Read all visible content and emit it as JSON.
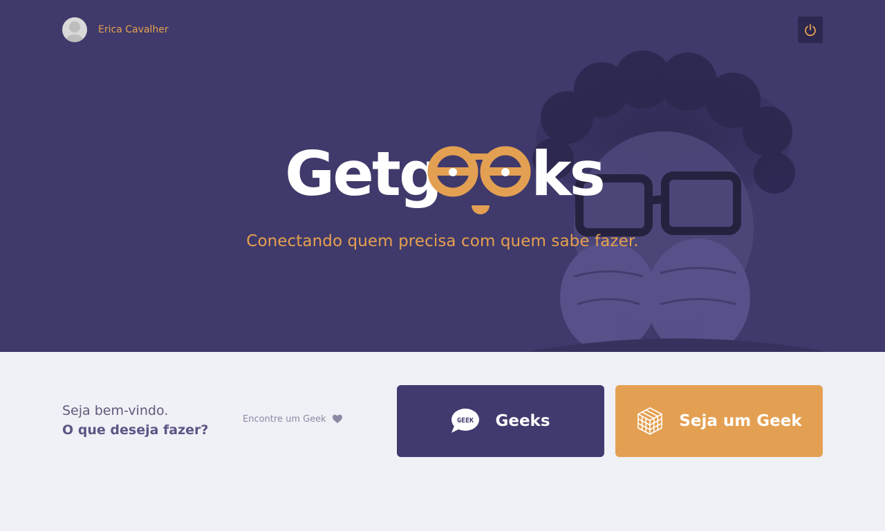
{
  "header": {
    "user_name": "Erica Cavalher",
    "avatar_icon": "user-avatar-icon",
    "logout_icon": "power-icon"
  },
  "hero": {
    "logo_text_white_1": "Getg",
    "logo_text_white_2": "ks",
    "tagline": "Conectando quem precisa com quem sabe fazer."
  },
  "welcome": {
    "line1": "Seja bem-vindo.",
    "line2": "O que deseja fazer?"
  },
  "find_link": {
    "label": "Encontre um Geek",
    "icon": "heart-icon"
  },
  "actions": {
    "geeks_label": "Geeks",
    "geeks_icon_text": "GEEK",
    "be_geek_label": "Seja um Geek"
  },
  "colors": {
    "hero_bg": "#3f3a6b",
    "accent_orange": "#e8a050",
    "page_bg": "#f0f0f7",
    "geeks_button": "#403a6e",
    "be_geek_button": "#e4a052"
  }
}
